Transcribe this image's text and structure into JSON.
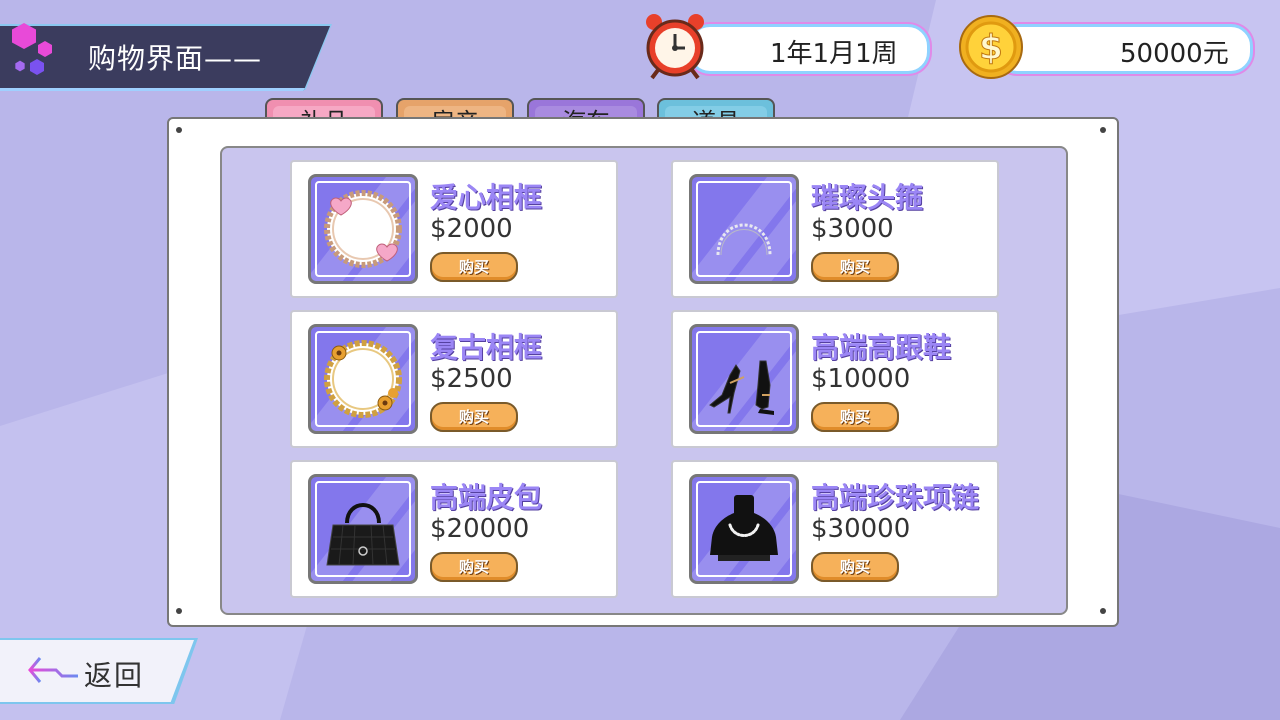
{
  "header": {
    "title": "购物界面——"
  },
  "status": {
    "date": "1年1月1周",
    "money": "50000元",
    "clock_icon": "alarm-clock-icon",
    "coin_icon": "dollar-coin-icon"
  },
  "tabs": [
    {
      "label": "礼品",
      "color": "#f08fb0",
      "selected": true
    },
    {
      "label": "房产",
      "color": "#e6a36a",
      "selected": false
    },
    {
      "label": "汽车",
      "color": "#9a76da",
      "selected": false
    },
    {
      "label": "道具",
      "color": "#6cc0dc",
      "selected": false
    }
  ],
  "items": [
    {
      "name": "爱心相框",
      "price": "$2000",
      "buy": "购买",
      "icon": "heart-frame-icon"
    },
    {
      "name": "璀璨头箍",
      "price": "$3000",
      "buy": "购买",
      "icon": "tiara-icon"
    },
    {
      "name": "复古相框",
      "price": "$2500",
      "buy": "购买",
      "icon": "vintage-frame-icon"
    },
    {
      "name": "高端高跟鞋",
      "price": "$10000",
      "buy": "购买",
      "icon": "high-heels-icon"
    },
    {
      "name": "高端皮包",
      "price": "$20000",
      "buy": "购买",
      "icon": "handbag-icon"
    },
    {
      "name": "高端珍珠项链",
      "price": "$30000",
      "buy": "购买",
      "icon": "pearl-necklace-icon"
    }
  ],
  "footer": {
    "back_label": "返回"
  }
}
